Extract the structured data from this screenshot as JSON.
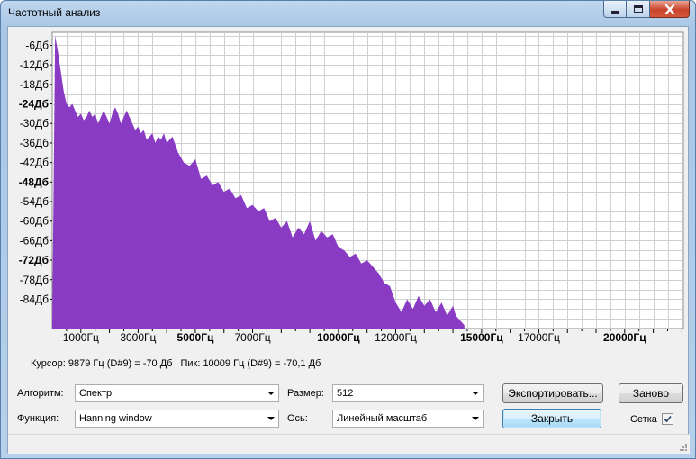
{
  "window": {
    "title": "Частотный анализ"
  },
  "colors": {
    "spectrum_fill": "#8a3bc4",
    "grid": "#d0d0d0",
    "plot_bg": "#ffffff"
  },
  "chart_data": {
    "type": "area",
    "title": "",
    "xlabel": "",
    "ylabel": "",
    "grid": true,
    "x_ticks": [
      "1000Гц",
      "3000Гц",
      "5000Гц",
      "7000Гц",
      "10000Гц",
      "12000Гц",
      "15000Гц",
      "17000Гц",
      "20000Гц"
    ],
    "x_tick_values": [
      1000,
      3000,
      5000,
      7000,
      10000,
      12000,
      15000,
      17000,
      20000
    ],
    "y_ticks": [
      "-6Дб",
      "-12Дб",
      "-18Дб",
      "-24Дб",
      "-30Дб",
      "-36Дб",
      "-42Дб",
      "-48Дб",
      "-54Дб",
      "-60Дб",
      "-66Дб",
      "-72Дб",
      "-78Дб",
      "-84Дб"
    ],
    "y_tick_values": [
      -6,
      -12,
      -18,
      -24,
      -30,
      -36,
      -42,
      -48,
      -54,
      -60,
      -66,
      -72,
      -78,
      -84
    ],
    "xlim": [
      0,
      22050
    ],
    "ylim": [
      -93,
      -2
    ],
    "x": [
      0,
      100,
      200,
      300,
      400,
      500,
      600,
      700,
      800,
      900,
      1000,
      1100,
      1200,
      1300,
      1400,
      1500,
      1600,
      1700,
      1800,
      1900,
      2000,
      2100,
      2200,
      2300,
      2400,
      2500,
      2600,
      2700,
      2800,
      2900,
      3000,
      3100,
      3200,
      3300,
      3400,
      3500,
      3600,
      3700,
      3800,
      3900,
      4000,
      4200,
      4400,
      4600,
      4800,
      5000,
      5200,
      5400,
      5600,
      5800,
      6000,
      6200,
      6400,
      6600,
      6800,
      7000,
      7200,
      7400,
      7600,
      7800,
      8000,
      8200,
      8400,
      8600,
      8800,
      9000,
      9200,
      9400,
      9600,
      9800,
      10000,
      10200,
      10400,
      10600,
      10800,
      11000,
      11200,
      11400,
      11600,
      11800,
      12000,
      12200,
      12400,
      12600,
      12800,
      13000,
      13200,
      13400,
      13600,
      13800,
      14000,
      14100,
      14200,
      14300,
      14400
    ],
    "y": [
      -92,
      -3,
      -8,
      -14,
      -20,
      -24,
      -25,
      -24,
      -26,
      -28,
      -27,
      -29,
      -28,
      -26,
      -28,
      -27,
      -30,
      -28,
      -26,
      -28,
      -30,
      -27,
      -25,
      -27,
      -30,
      -28,
      -26,
      -28,
      -30,
      -32,
      -31,
      -33,
      -32,
      -35,
      -34,
      -33,
      -36,
      -34,
      -35,
      -33,
      -36,
      -34,
      -39,
      -42,
      -43,
      -41,
      -47,
      -46,
      -49,
      -48,
      -51,
      -50,
      -53,
      -52,
      -56,
      -55,
      -57,
      -56,
      -60,
      -59,
      -62,
      -60,
      -65,
      -62,
      -64,
      -60,
      -66,
      -63,
      -65,
      -64,
      -68,
      -69,
      -71,
      -70,
      -73,
      -72,
      -74,
      -76,
      -79,
      -80,
      -85,
      -88,
      -84,
      -87,
      -83,
      -86,
      -84,
      -88,
      -85,
      -89,
      -86,
      -89,
      -90,
      -91,
      -92
    ]
  },
  "status": {
    "cursor": "Курсор: 9879 Гц (D#9) = -70 Дб",
    "peak": "Пик: 10009 Гц (D#9) = -70,1 Дб"
  },
  "controls": {
    "algorithm_label": "Алгоритм:",
    "algorithm_value": "Спектр",
    "function_label": "Функция:",
    "function_value": "Hanning window",
    "size_label": "Размер:",
    "size_value": "512",
    "axis_label": "Ось:",
    "axis_value": "Линейный масштаб",
    "export_button": "Экспортировать...",
    "redo_button": "Заново",
    "close_button": "Закрыть",
    "grid_label": "Сетка",
    "grid_checked": true
  }
}
